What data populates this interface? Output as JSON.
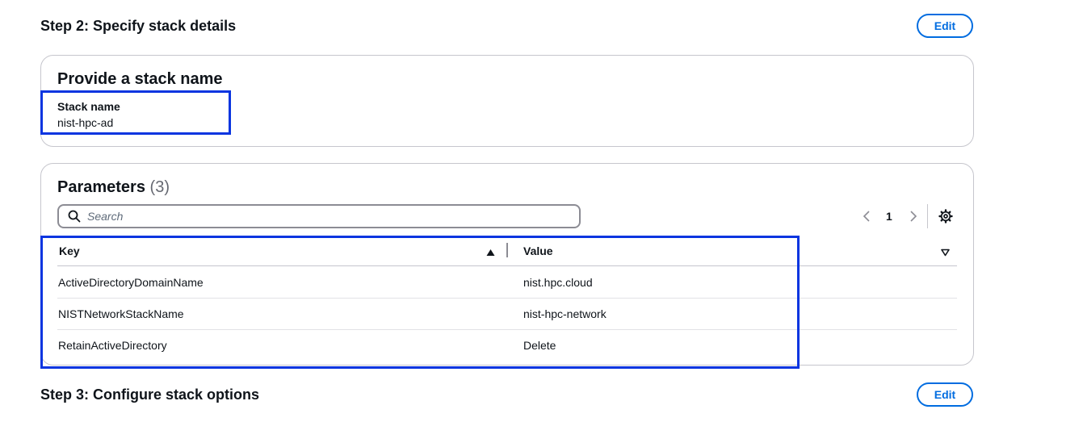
{
  "step2": {
    "title": "Step 2: Specify stack details",
    "edit_label": "Edit",
    "stack_name_card": {
      "title": "Provide a stack name",
      "field_label": "Stack name",
      "field_value": "nist-hpc-ad"
    },
    "parameters": {
      "title": "Parameters",
      "count": "(3)",
      "search_placeholder": "Search",
      "page": "1",
      "columns": {
        "key": "Key",
        "value": "Value"
      },
      "rows": [
        {
          "key": "ActiveDirectoryDomainName",
          "value": "nist.hpc.cloud"
        },
        {
          "key": "NISTNetworkStackName",
          "value": "nist-hpc-network"
        },
        {
          "key": "RetainActiveDirectory",
          "value": "Delete"
        }
      ]
    }
  },
  "step3": {
    "title": "Step 3: Configure stack options",
    "edit_label": "Edit"
  },
  "colors": {
    "accent": "#006ce0",
    "highlight": "#0a35e0",
    "border": "#c6c6cd"
  },
  "icons": [
    "search-icon",
    "chevron-left-icon",
    "chevron-right-icon",
    "gear-icon",
    "sort-ascending-icon",
    "sort-descending-icon"
  ]
}
